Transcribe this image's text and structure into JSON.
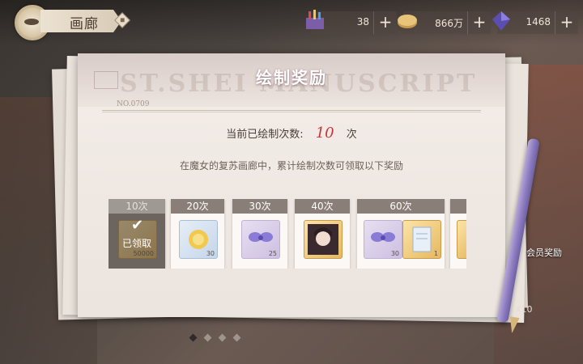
{
  "header": {
    "title": "画廊"
  },
  "resources": [
    {
      "name": "paint-set",
      "value": "38"
    },
    {
      "name": "coin",
      "value": "866万"
    },
    {
      "name": "crystal",
      "value": "1468"
    }
  ],
  "popup": {
    "title": "绘制奖励",
    "watermark": "ST.SHEI     MANUSCRIPT",
    "doc_no": "NO.0709",
    "count_label": "当前已绘制次数:",
    "count_value": "10",
    "count_unit": "次",
    "description": "在魔女的复苏画廊中，累计绘制次数可领取以下奖励"
  },
  "tiers": [
    {
      "label": "10次",
      "claimed_label": "已领取",
      "items": [
        {
          "icon": "coin-pot-icon",
          "qty": "50000"
        }
      ]
    },
    {
      "label": "20次",
      "items": [
        {
          "icon": "sun-medal-icon",
          "qty": "30"
        }
      ]
    },
    {
      "label": "30次",
      "items": [
        {
          "icon": "butterfly-bow-icon",
          "qty": "25"
        }
      ]
    },
    {
      "label": "40次",
      "items": [
        {
          "icon": "character-portrait-icon",
          "qty": ""
        }
      ]
    },
    {
      "label": "60次",
      "items": [
        {
          "icon": "butterfly-bow-icon",
          "qty": "30"
        },
        {
          "icon": "letter-card-icon",
          "qty": "1"
        }
      ]
    }
  ],
  "side": {
    "label": "会员奖励",
    "count": "X10"
  }
}
